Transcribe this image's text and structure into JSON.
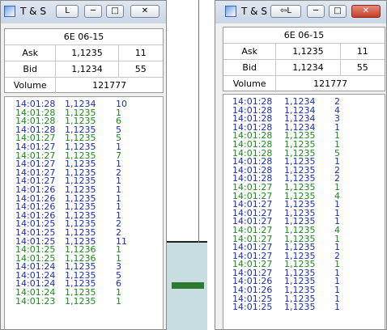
{
  "colors": {
    "buy": "#1a8a1a",
    "sell": "#1c2fb0",
    "desktop": "#ffffff"
  },
  "left_window": {
    "title": "T & S",
    "lock_button": "L",
    "info": {
      "contract": "6E 06-15",
      "ask_label": "Ask",
      "ask_price": "1,1235",
      "ask_size": "11",
      "bid_label": "Bid",
      "bid_price": "1,1234",
      "bid_size": "55",
      "volume_label": "Volume",
      "volume": "121777"
    },
    "trades": [
      {
        "time": "14:01:28",
        "price": "1,1234",
        "size": "10",
        "side": "sell"
      },
      {
        "time": "14:01:28",
        "price": "1,1235",
        "size": "1",
        "side": "buy"
      },
      {
        "time": "14:01:28",
        "price": "1,1235",
        "size": "6",
        "side": "buy"
      },
      {
        "time": "14:01:28",
        "price": "1,1235",
        "size": "5",
        "side": "sell"
      },
      {
        "time": "14:01:27",
        "price": "1,1235",
        "size": "5",
        "side": "buy"
      },
      {
        "time": "14:01:27",
        "price": "1,1235",
        "size": "1",
        "side": "sell"
      },
      {
        "time": "14:01:27",
        "price": "1,1235",
        "size": "7",
        "side": "buy"
      },
      {
        "time": "14:01:27",
        "price": "1,1235",
        "size": "1",
        "side": "sell"
      },
      {
        "time": "14:01:27",
        "price": "1,1235",
        "size": "2",
        "side": "sell"
      },
      {
        "time": "14:01:27",
        "price": "1,1235",
        "size": "1",
        "side": "sell"
      },
      {
        "time": "14:01:26",
        "price": "1,1235",
        "size": "1",
        "side": "sell"
      },
      {
        "time": "14:01:26",
        "price": "1,1235",
        "size": "1",
        "side": "sell"
      },
      {
        "time": "14:01:26",
        "price": "1,1235",
        "size": "1",
        "side": "sell"
      },
      {
        "time": "14:01:26",
        "price": "1,1235",
        "size": "1",
        "side": "sell"
      },
      {
        "time": "14:01:25",
        "price": "1,1235",
        "size": "2",
        "side": "sell"
      },
      {
        "time": "14:01:25",
        "price": "1,1235",
        "size": "2",
        "side": "sell"
      },
      {
        "time": "14:01:25",
        "price": "1,1235",
        "size": "11",
        "side": "sell"
      },
      {
        "time": "14:01:25",
        "price": "1,1236",
        "size": "1",
        "side": "buy"
      },
      {
        "time": "14:01:25",
        "price": "1,1236",
        "size": "1",
        "side": "buy"
      },
      {
        "time": "14:01:24",
        "price": "1,1235",
        "size": "3",
        "side": "sell"
      },
      {
        "time": "14:01:24",
        "price": "1,1235",
        "size": "5",
        "side": "sell"
      },
      {
        "time": "14:01:24",
        "price": "1,1235",
        "size": "6",
        "side": "sell"
      },
      {
        "time": "14:01:24",
        "price": "1,1235",
        "size": "1",
        "side": "buy"
      },
      {
        "time": "14:01:23",
        "price": "1,1235",
        "size": "1",
        "side": "buy"
      }
    ]
  },
  "right_window": {
    "title": "T & S",
    "lock_button": "L",
    "info": {
      "contract": "6E 06-15",
      "ask_label": "Ask",
      "ask_price": "1,1235",
      "ask_size": "11",
      "bid_label": "Bid",
      "bid_price": "1,1234",
      "bid_size": "55",
      "volume_label": "Volume",
      "volume": "121777"
    },
    "trades": [
      {
        "time": "14:01:28",
        "price": "1,1234",
        "size": "2",
        "side": "sell"
      },
      {
        "time": "14:01:28",
        "price": "1,1234",
        "size": "4",
        "side": "sell"
      },
      {
        "time": "14:01:28",
        "price": "1,1234",
        "size": "3",
        "side": "sell"
      },
      {
        "time": "14:01:28",
        "price": "1,1234",
        "size": "1",
        "side": "sell"
      },
      {
        "time": "14:01:28",
        "price": "1,1235",
        "size": "1",
        "side": "buy"
      },
      {
        "time": "14:01:28",
        "price": "1,1235",
        "size": "1",
        "side": "buy"
      },
      {
        "time": "14:01:28",
        "price": "1,1235",
        "size": "5",
        "side": "buy"
      },
      {
        "time": "14:01:28",
        "price": "1,1235",
        "size": "1",
        "side": "sell"
      },
      {
        "time": "14:01:28",
        "price": "1,1235",
        "size": "2",
        "side": "sell"
      },
      {
        "time": "14:01:28",
        "price": "1,1235",
        "size": "2",
        "side": "sell"
      },
      {
        "time": "14:01:27",
        "price": "1,1235",
        "size": "1",
        "side": "buy"
      },
      {
        "time": "14:01:27",
        "price": "1,1235",
        "size": "4",
        "side": "buy"
      },
      {
        "time": "14:01:27",
        "price": "1,1235",
        "size": "1",
        "side": "sell"
      },
      {
        "time": "14:01:27",
        "price": "1,1235",
        "size": "1",
        "side": "sell"
      },
      {
        "time": "14:01:27",
        "price": "1,1235",
        "size": "1",
        "side": "sell"
      },
      {
        "time": "14:01:27",
        "price": "1,1235",
        "size": "4",
        "side": "buy"
      },
      {
        "time": "14:01:27",
        "price": "1,1235",
        "size": "1",
        "side": "buy"
      },
      {
        "time": "14:01:27",
        "price": "1,1235",
        "size": "1",
        "side": "sell"
      },
      {
        "time": "14:01:27",
        "price": "1,1235",
        "size": "2",
        "side": "sell"
      },
      {
        "time": "14:01:27",
        "price": "1,1235",
        "size": "1",
        "side": "buy"
      },
      {
        "time": "14:01:27",
        "price": "1,1235",
        "size": "1",
        "side": "sell"
      },
      {
        "time": "14:01:26",
        "price": "1,1235",
        "size": "1",
        "side": "sell"
      },
      {
        "time": "14:01:26",
        "price": "1,1235",
        "size": "1",
        "side": "sell"
      },
      {
        "time": "14:01:25",
        "price": "1,1235",
        "size": "1",
        "side": "sell"
      },
      {
        "time": "14:01:25",
        "price": "1,1235",
        "size": "1",
        "side": "sell"
      }
    ]
  }
}
